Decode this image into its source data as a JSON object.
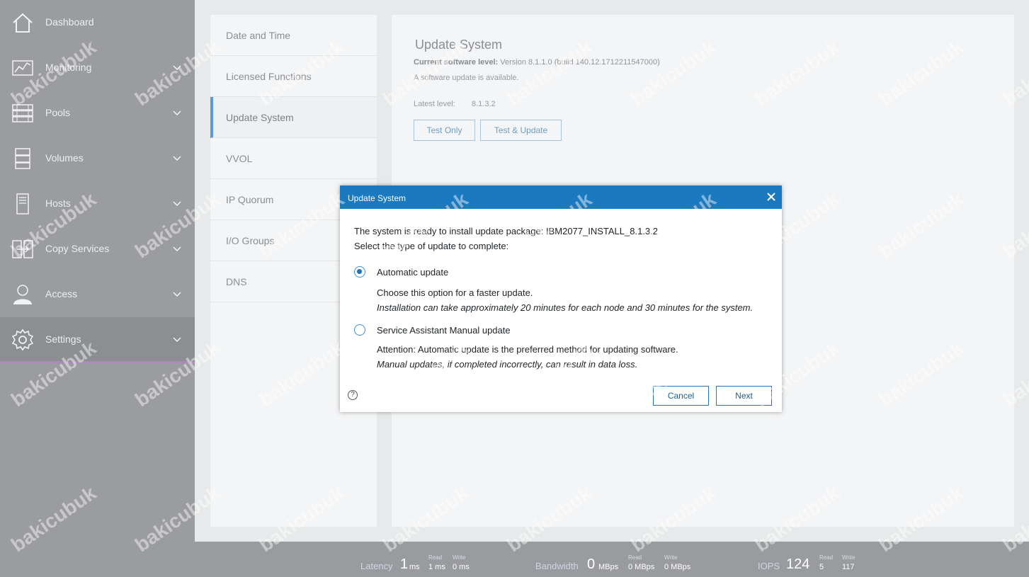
{
  "sidebar": {
    "items": [
      {
        "label": "Dashboard",
        "icon": "home-icon"
      },
      {
        "label": "Monitoring",
        "icon": "monitoring-icon"
      },
      {
        "label": "Pools",
        "icon": "pools-icon"
      },
      {
        "label": "Volumes",
        "icon": "volumes-icon"
      },
      {
        "label": "Hosts",
        "icon": "hosts-icon"
      },
      {
        "label": "Copy Services",
        "icon": "copy-services-icon"
      },
      {
        "label": "Access",
        "icon": "access-icon"
      },
      {
        "label": "Settings",
        "icon": "gear-icon",
        "active": true
      }
    ]
  },
  "settings_menu": {
    "items": [
      "Date and Time",
      "Licensed Functions",
      "Update System",
      "VVOL",
      "IP Quorum",
      "I/O Groups",
      "DNS"
    ],
    "active": "Update System"
  },
  "content": {
    "title": "Update System",
    "current_level_label": "Current software level:",
    "current_level_value": "Version 8.1.1.0 (build 140.12.1712211547000)",
    "available_text": "A software update is available.",
    "latest_label": "Latest level:",
    "latest_value": "8.1.3.2",
    "test_only_label": "Test Only",
    "test_update_label": "Test & Update"
  },
  "modal": {
    "title": "Update System",
    "line1": "The system is ready to install update package: IBM2077_INSTALL_8.1.3.2",
    "line2": "Select the type of update to complete:",
    "option1_label": "Automatic update",
    "option1_desc": "Choose this option for a faster update.",
    "option1_note": "Installation can take approximately 20 minutes for each node and 30 minutes for the system.",
    "option2_label": "Service Assistant Manual update",
    "option2_desc": "Attention: Automatic update is the preferred method for updating software.",
    "option2_note": "Manual updates, if completed incorrectly, can result in data loss.",
    "selected_option": "Automatic update",
    "help_glyph": "?",
    "cancel_label": "Cancel",
    "next_label": "Next"
  },
  "footer": {
    "latency": {
      "label": "Latency",
      "value": "1",
      "unit": "ms",
      "read_label": "Read",
      "read_value": "1 ms",
      "write_label": "Write",
      "write_value": "0 ms"
    },
    "bandwidth": {
      "label": "Bandwidth",
      "value": "0",
      "unit": "MBps",
      "read_label": "Read",
      "read_value": "0 MBps",
      "write_label": "Write",
      "write_value": "0 MBps"
    },
    "iops": {
      "label": "IOPS",
      "value": "124",
      "read_label": "Read",
      "read_value": "5",
      "write_label": "Write",
      "write_value": "117"
    }
  },
  "watermark": "bakicubuk",
  "colors": {
    "modal_header": "#1a79bf",
    "accent": "#5b9ad5",
    "sidebar_bg": "#9b9c9f",
    "active_underline": "#b87fc9"
  }
}
